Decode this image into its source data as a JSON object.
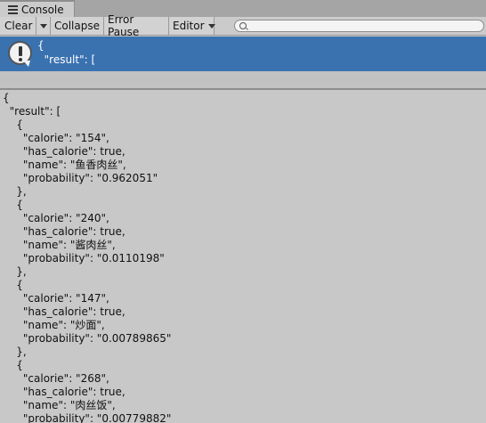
{
  "tab": {
    "label": "Console",
    "icon": "console-list-icon"
  },
  "toolbar": {
    "clear_label": "Clear",
    "collapse_label": "Collapse",
    "error_pause_label": "Error Pause",
    "editor_label": "Editor",
    "search_value": ""
  },
  "log_entry": {
    "line1": "{",
    "line2": "  \"result\": [",
    "icon": "info-warning-icon",
    "highlight_color": "#3a72b0"
  },
  "detail": {
    "lines": [
      "{",
      "  \"result\": [",
      "    {",
      "      \"calorie\": \"154\",",
      "      \"has_calorie\": true,",
      "      \"name\": \"鱼香肉丝\",",
      "      \"probability\": \"0.962051\"",
      "    },",
      "    {",
      "      \"calorie\": \"240\",",
      "      \"has_calorie\": true,",
      "      \"name\": \"酱肉丝\",",
      "      \"probability\": \"0.0110198\"",
      "    },",
      "    {",
      "      \"calorie\": \"147\",",
      "      \"has_calorie\": true,",
      "      \"name\": \"炒面\",",
      "      \"probability\": \"0.00789865\"",
      "    },",
      "    {",
      "      \"calorie\": \"268\",",
      "      \"has_calorie\": true,",
      "      \"name\": \"肉丝饭\",",
      "      \"probability\": \"0.00779882\""
    ]
  }
}
